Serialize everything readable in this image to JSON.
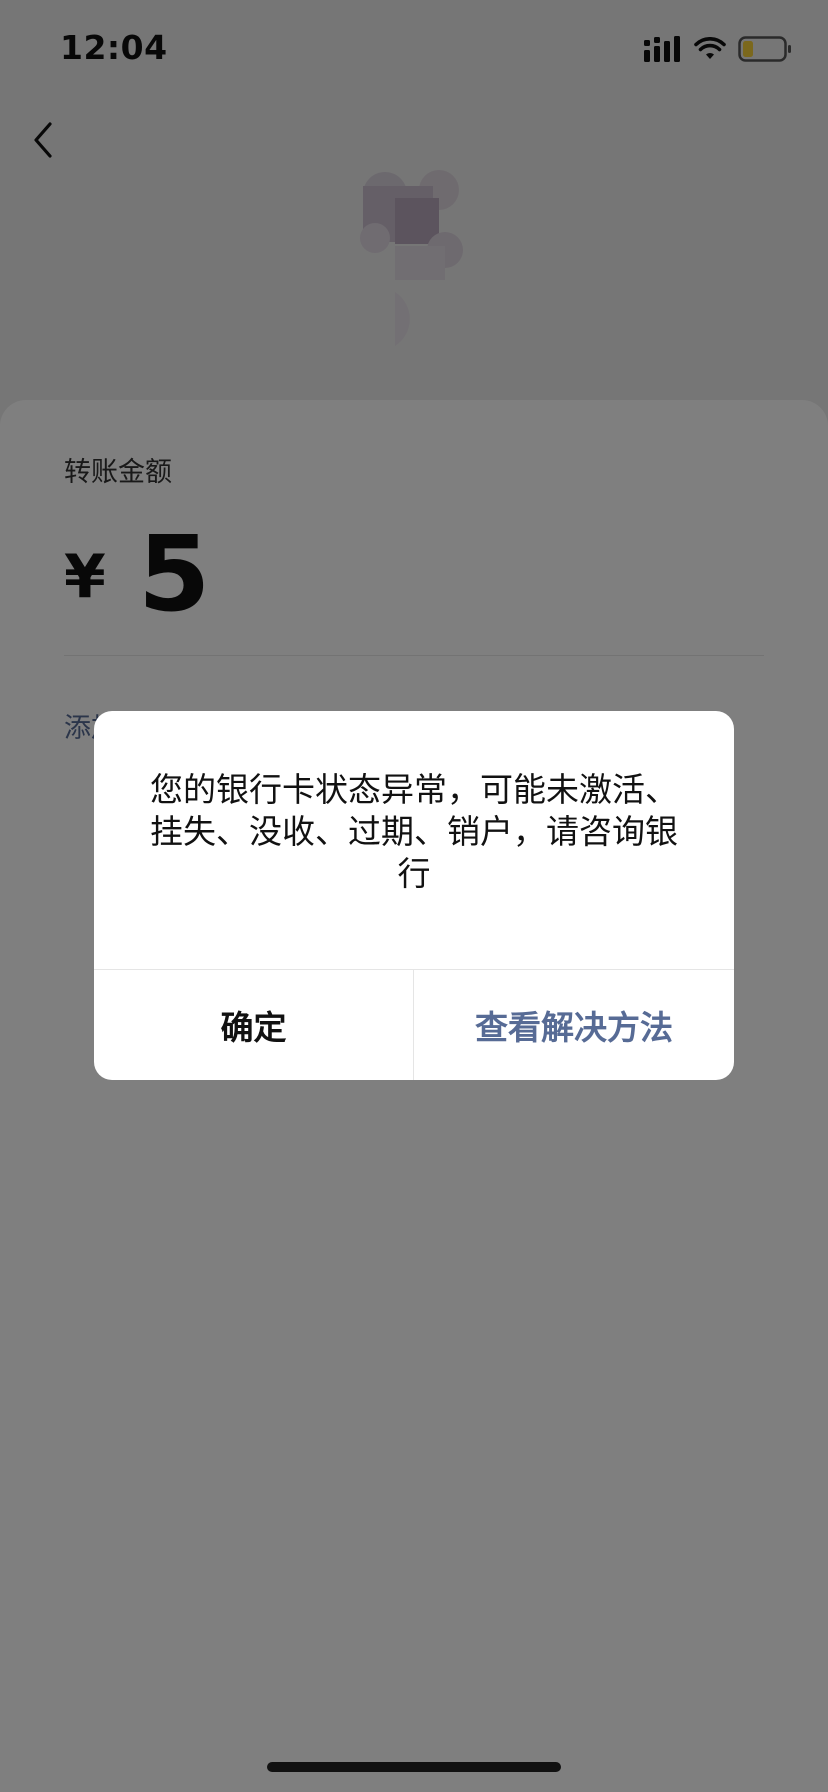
{
  "status_bar": {
    "time": "12:04"
  },
  "transfer": {
    "amount_label": "转账金额",
    "currency_symbol": "¥",
    "amount": "5",
    "add_note_link": "添加转账说明"
  },
  "dialog": {
    "message": "您的银行卡状态异常，可能未激活、挂失、没收、过期、销户，请咨询银行",
    "confirm_label": "确定",
    "solution_label": "查看解决方法"
  },
  "colors": {
    "link": "#576b95",
    "overlay": "rgba(0,0,0,0.5)",
    "battery_fill": "#f7d13a"
  },
  "icons": {
    "back": "chevron-left-icon",
    "signal": "signal-icon",
    "wifi": "wifi-icon",
    "battery": "battery-icon"
  }
}
